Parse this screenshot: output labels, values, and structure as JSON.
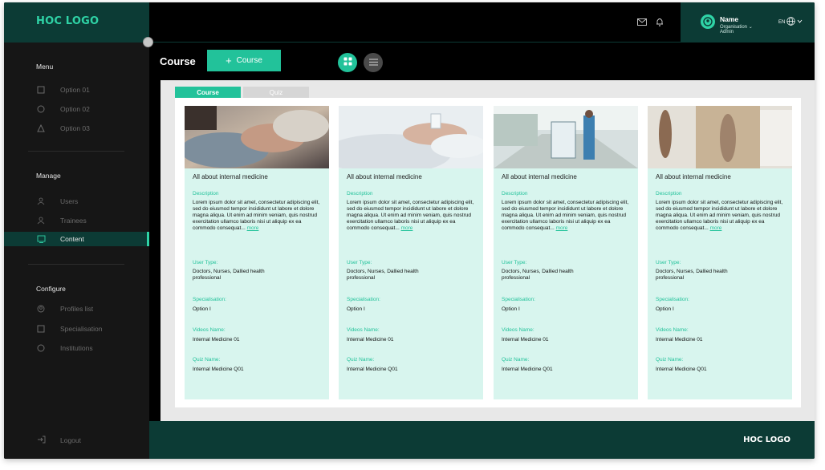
{
  "brand": {
    "logo": "HOC LOGO",
    "accent": "#22c29a",
    "dark_teal": "#0c3b35"
  },
  "sidebar": {
    "sections": [
      {
        "title": "Menu",
        "items": [
          {
            "label": "Option 01",
            "icon": "square-icon"
          },
          {
            "label": "Option 02",
            "icon": "circle-icon"
          },
          {
            "label": "Option 03",
            "icon": "triangle-icon"
          }
        ]
      },
      {
        "title": "Manage",
        "items": [
          {
            "label": "Users",
            "icon": "users-icon"
          },
          {
            "label": "Trainees",
            "icon": "trainees-icon"
          },
          {
            "label": "Content",
            "icon": "content-icon",
            "active": true
          }
        ]
      },
      {
        "title": "Configure",
        "items": [
          {
            "label": "Profiles list",
            "icon": "profile-icon"
          },
          {
            "label": "Specialisation",
            "icon": "square-icon"
          },
          {
            "label": "Institutions",
            "icon": "circle-icon"
          }
        ]
      }
    ],
    "logout": "Logout"
  },
  "topbar": {
    "user_name": "Name",
    "organisation": "Organisation",
    "role": "Admin",
    "language": "EN"
  },
  "main": {
    "title": "Course",
    "add_button": "Course",
    "tabs": [
      "Course",
      "Quiz"
    ]
  },
  "card_labels": {
    "description": "Description",
    "user_type": "User Type:",
    "specialisation": "Specialisation:",
    "videos": "Videos Name:",
    "quiz": "Quiz Name:",
    "more": "more"
  },
  "cards": [
    {
      "title": "All about internal medicine",
      "description": "Lorem ipsum dolor sit amet, consectetur adipiscing elit, sed do eiusmod tempor incididunt ut labore et dolore magna aliqua. Ut enim ad minim veniam, quis nostrud exercitation ullamco laboris nisi ut aliquip ex ea commodo consequat...",
      "user_type": "Doctors, Nurses, Dallied health professional",
      "specialisation": "Option I",
      "video": "Internal Medicine 01",
      "quiz": "Internal Medicine Q01"
    },
    {
      "title": "All about internal medicine",
      "description": "Lorem ipsum dolor sit amet, consectetur adipiscing elit, sed do eiusmod tempor incididunt ut labore et dolore magna aliqua. Ut enim ad minim veniam, quis nostrud exercitation ullamco laboris nisi ut aliquip ex ea commodo consequat...",
      "user_type": "Doctors, Nurses, Dallied health professional",
      "specialisation": "Option I",
      "video": "Internal Medicine 01",
      "quiz": "Internal Medicine Q01"
    },
    {
      "title": "All about internal medicine",
      "description": "Lorem ipsum dolor sit amet, consectetur adipiscing elit, sed do eiusmod tempor incididunt ut labore et dolore magna aliqua. Ut enim ad minim veniam, quis nostrud exercitation ullamco laboris nisi ut aliquip ex ea commodo consequat...",
      "user_type": "Doctors, Nurses, Dallied health professional",
      "specialisation": "Option I",
      "video": "Internal Medicine 01",
      "quiz": "Internal Medicine Q01"
    },
    {
      "title": "All about internal medicine",
      "description": "Lorem ipsum dolor sit amet, consectetur adipiscing elit, sed do eiusmod tempor incididunt ut labore et dolore magna aliqua. Ut enim ad minim veniam, quis nostrud exercitation ullamco laboris nisi ut aliquip ex ea commodo consequat...",
      "user_type": "Doctors, Nurses, Dallied health professional",
      "specialisation": "Option I",
      "video": "Internal Medicine 01",
      "quiz": "Internal Medicine Q01"
    }
  ],
  "footer": {
    "logo": "HOC LOGO"
  }
}
